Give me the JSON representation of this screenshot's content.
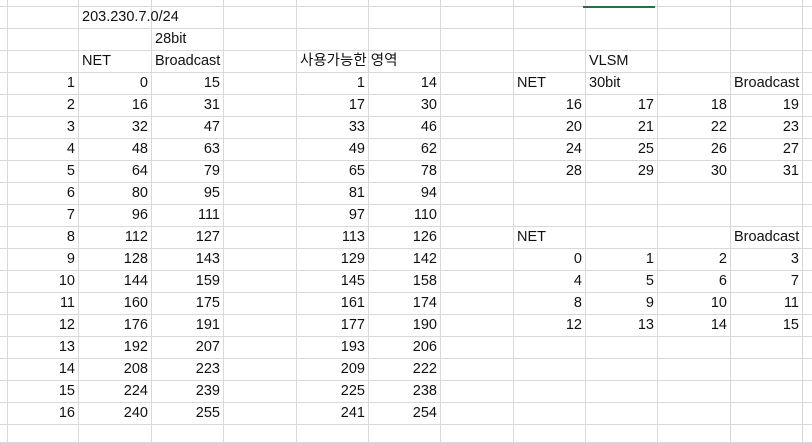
{
  "sheet": {
    "network": "203.230.7.0/24",
    "bits_28": "28bit",
    "net_label": "NET",
    "broadcast_label": "Broadcast",
    "usable_label": "사용가능한 영역",
    "vlsm_label": "VLSM",
    "bits_30": "30bit",
    "accent_color": "#217346"
  },
  "subnets": [
    {
      "idx": "1",
      "net": "0",
      "bc": "15",
      "first": "1",
      "last": "14"
    },
    {
      "idx": "2",
      "net": "16",
      "bc": "31",
      "first": "17",
      "last": "30"
    },
    {
      "idx": "3",
      "net": "32",
      "bc": "47",
      "first": "33",
      "last": "46"
    },
    {
      "idx": "4",
      "net": "48",
      "bc": "63",
      "first": "49",
      "last": "62"
    },
    {
      "idx": "5",
      "net": "64",
      "bc": "79",
      "first": "65",
      "last": "78"
    },
    {
      "idx": "6",
      "net": "80",
      "bc": "95",
      "first": "81",
      "last": "94"
    },
    {
      "idx": "7",
      "net": "96",
      "bc": "111",
      "first": "97",
      "last": "110"
    },
    {
      "idx": "8",
      "net": "112",
      "bc": "127",
      "first": "113",
      "last": "126"
    },
    {
      "idx": "9",
      "net": "128",
      "bc": "143",
      "first": "129",
      "last": "142"
    },
    {
      "idx": "10",
      "net": "144",
      "bc": "159",
      "first": "145",
      "last": "158"
    },
    {
      "idx": "11",
      "net": "160",
      "bc": "175",
      "first": "161",
      "last": "174"
    },
    {
      "idx": "12",
      "net": "176",
      "bc": "191",
      "first": "177",
      "last": "190"
    },
    {
      "idx": "13",
      "net": "192",
      "bc": "207",
      "first": "193",
      "last": "206"
    },
    {
      "idx": "14",
      "net": "208",
      "bc": "223",
      "first": "209",
      "last": "222"
    },
    {
      "idx": "15",
      "net": "224",
      "bc": "239",
      "first": "225",
      "last": "238"
    },
    {
      "idx": "16",
      "net": "240",
      "bc": "255",
      "first": "241",
      "last": "254"
    }
  ],
  "vlsm_upper": [
    [
      "16",
      "17",
      "18",
      "19"
    ],
    [
      "20",
      "21",
      "22",
      "23"
    ],
    [
      "24",
      "25",
      "26",
      "27"
    ],
    [
      "28",
      "29",
      "30",
      "31"
    ]
  ],
  "vlsm_lower": [
    [
      "0",
      "1",
      "2",
      "3"
    ],
    [
      "4",
      "5",
      "6",
      "7"
    ],
    [
      "8",
      "9",
      "10",
      "11"
    ],
    [
      "12",
      "13",
      "14",
      "15"
    ]
  ]
}
